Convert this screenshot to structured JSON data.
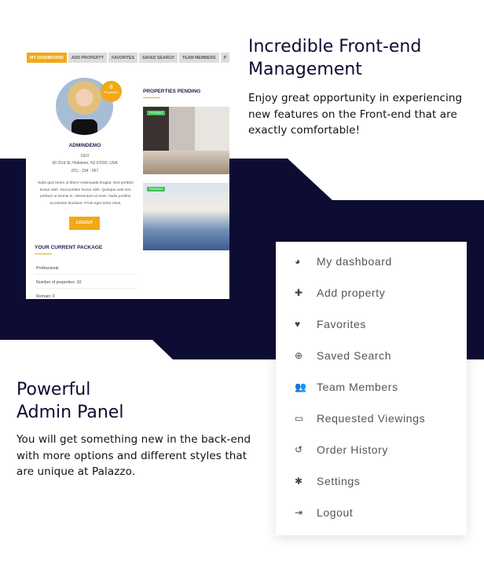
{
  "colors": {
    "navy": "#0d0c33",
    "accent": "#f2a914",
    "pending": "#44c256"
  },
  "front": {
    "title_line1": "Incredible Front-end",
    "title_line2": "Management",
    "desc_lines": [
      "Enjoy great opportunity in experiencing",
      "new features on the Front-end  that are",
      "exactly comfortable!"
    ]
  },
  "admin": {
    "title_line1": "Powerful",
    "title_line2": "Admin Panel",
    "desc_lines": [
      "You will get something new in the back-end",
      "with more options and different styles that",
      "are unique at Palazzo."
    ]
  },
  "screenshot": {
    "tabs": [
      "MY DASHBOARD",
      "ADD PROPERTY",
      "FAVORITES",
      "SAVED SEARCH",
      "TEAM MEMBERS",
      "P"
    ],
    "badge_count": "0",
    "badge_label": "Properties",
    "name": "ADMINDEMO",
    "role": "CEO",
    "address": "60 31rd St, Hoboken, NJ 07030, USA",
    "phone": "(01) - 234 - 567",
    "bio": "Nulla quis lorem ut libero malesuada feugiat. Sed porttitor lectus nibh. Sed porttitor lectus nibh. Quisque velit nisi, pretium ut lacinia in, elementum id enim. Nulla porttitor accumsan tincidunt. Proin eget tortor risus.",
    "logout": "LOGOUT",
    "package_title": "YOUR CURRENT PACKAGE",
    "package_rows": [
      "Professional",
      "Number of properties: 10",
      "Remain: 0"
    ],
    "pending_title": "PROPERTIES PENDING",
    "pending_badge": "PENDING"
  },
  "menu": [
    {
      "icon": "dashboard-icon",
      "glyph": "◕",
      "label": "My dashboard"
    },
    {
      "icon": "plus-icon",
      "glyph": "✚",
      "label": "Add property"
    },
    {
      "icon": "heart-icon",
      "glyph": "♥",
      "label": "Favorites"
    },
    {
      "icon": "search-plus-icon",
      "glyph": "⊕",
      "label": "Saved Search"
    },
    {
      "icon": "users-icon",
      "glyph": "👥",
      "label": "Team Members"
    },
    {
      "icon": "inbox-icon",
      "glyph": "▭",
      "label": "Requested Viewings"
    },
    {
      "icon": "history-icon",
      "glyph": "↺",
      "label": "Order History"
    },
    {
      "icon": "gear-icon",
      "glyph": "✱",
      "label": "Settings"
    },
    {
      "icon": "sign-out-icon",
      "glyph": "⇥",
      "label": "Logout"
    }
  ]
}
